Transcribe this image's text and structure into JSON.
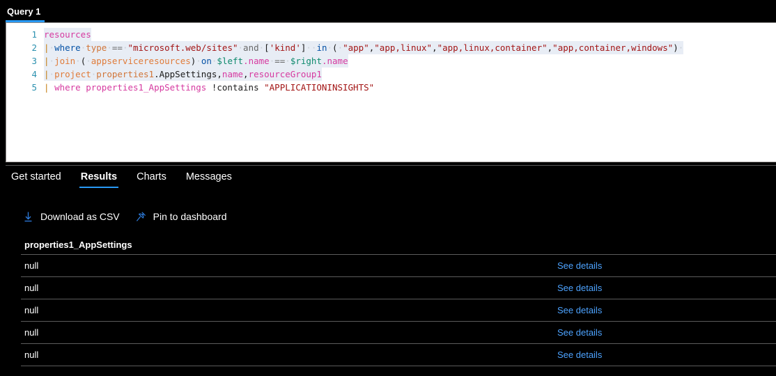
{
  "query_tab": {
    "label": "Query 1"
  },
  "editor": {
    "lines": [
      {
        "num": "1",
        "text": "resources"
      },
      {
        "num": "2",
        "text": "| where type == \"microsoft.web/sites\" and ['kind'] in ( \"app\",\"app,linux\",\"app,linux,container\",\"app,container,windows\")"
      },
      {
        "num": "3",
        "text": "| join ( appserviceresources) on $left.name == $right.name"
      },
      {
        "num": "4",
        "text": "| project properties1.AppSettings,name,resourceGroup1"
      },
      {
        "num": "5",
        "text": "| where properties1_AppSettings !contains \"APPLICATIONINSIGHTS\""
      }
    ],
    "tokens": {
      "l1": [
        {
          "t": "resources",
          "c": "t-res"
        }
      ],
      "l2": [
        {
          "t": "|",
          "c": "t-pipe"
        },
        {
          "t": "·",
          "c": "t-ws"
        },
        {
          "t": "where",
          "c": "t-kw"
        },
        {
          "t": "·",
          "c": "t-ws"
        },
        {
          "t": "type",
          "c": "t-col"
        },
        {
          "t": "·",
          "c": "t-ws"
        },
        {
          "t": "==",
          "c": "t-op"
        },
        {
          "t": "·",
          "c": "t-ws"
        },
        {
          "t": "\"microsoft.web/sites\"",
          "c": "t-str"
        },
        {
          "t": "·",
          "c": "t-ws"
        },
        {
          "t": "and",
          "c": "t-op"
        },
        {
          "t": "·",
          "c": "t-ws"
        },
        {
          "t": "[",
          "c": "t-plain"
        },
        {
          "t": "'kind'",
          "c": "t-str"
        },
        {
          "t": "]",
          "c": "t-plain"
        },
        {
          "t": "·",
          "c": "t-ws"
        },
        {
          "t": "·",
          "c": "t-ws"
        },
        {
          "t": "in",
          "c": "t-kw"
        },
        {
          "t": "·",
          "c": "t-ws"
        },
        {
          "t": "(",
          "c": "t-plain"
        },
        {
          "t": "·",
          "c": "t-ws"
        },
        {
          "t": "\"app\"",
          "c": "t-str"
        },
        {
          "t": ",",
          "c": "t-plain"
        },
        {
          "t": "\"app,linux\"",
          "c": "t-str"
        },
        {
          "t": ",",
          "c": "t-plain"
        },
        {
          "t": "\"app,linux,container\"",
          "c": "t-str"
        },
        {
          "t": ",",
          "c": "t-plain"
        },
        {
          "t": "\"app,container,windows\"",
          "c": "t-str"
        },
        {
          "t": ")",
          "c": "t-plain"
        },
        {
          "t": "·",
          "c": "t-ws"
        }
      ],
      "l3": [
        {
          "t": "|",
          "c": "t-pipe"
        },
        {
          "t": "·",
          "c": "t-ws"
        },
        {
          "t": "join",
          "c": "t-fn"
        },
        {
          "t": "·",
          "c": "t-ws"
        },
        {
          "t": "(",
          "c": "t-plain"
        },
        {
          "t": "·",
          "c": "t-ws"
        },
        {
          "t": "appserviceresources",
          "c": "t-fn"
        },
        {
          "t": ")",
          "c": "t-plain"
        },
        {
          "t": "·",
          "c": "t-ws"
        },
        {
          "t": "on",
          "c": "t-kw"
        },
        {
          "t": "·",
          "c": "t-ws"
        },
        {
          "t": "$left",
          "c": "t-var"
        },
        {
          "t": ".name",
          "c": "t-mem"
        },
        {
          "t": "·",
          "c": "t-ws"
        },
        {
          "t": "==",
          "c": "t-op"
        },
        {
          "t": "·",
          "c": "t-ws"
        },
        {
          "t": "$right",
          "c": "t-var"
        },
        {
          "t": ".name",
          "c": "t-mem"
        }
      ],
      "l4": [
        {
          "t": "|",
          "c": "t-pipe"
        },
        {
          "t": "·",
          "c": "t-ws"
        },
        {
          "t": "project",
          "c": "t-fn"
        },
        {
          "t": "·",
          "c": "t-ws"
        },
        {
          "t": "properties1",
          "c": "t-col"
        },
        {
          "t": ".AppSettings",
          "c": "t-plain"
        },
        {
          "t": ",",
          "c": "t-plain"
        },
        {
          "t": "name",
          "c": "t-mem"
        },
        {
          "t": ",",
          "c": "t-plain"
        },
        {
          "t": "resourceGroup1",
          "c": "t-mem"
        }
      ],
      "l5": [
        {
          "t": "|",
          "c": "t-pipe"
        },
        {
          "t": " ",
          "c": "t-plain"
        },
        {
          "t": "where",
          "c": "t-res"
        },
        {
          "t": " ",
          "c": "t-plain"
        },
        {
          "t": "properties1_AppSettings",
          "c": "t-mem"
        },
        {
          "t": " ",
          "c": "t-plain"
        },
        {
          "t": "!contains",
          "c": "t-plain"
        },
        {
          "t": " ",
          "c": "t-plain"
        },
        {
          "t": "\"APPLICATIONINSIGHTS\"",
          "c": "t-str"
        }
      ]
    }
  },
  "result_tabs": [
    {
      "label": "Get started",
      "active": false
    },
    {
      "label": "Results",
      "active": true
    },
    {
      "label": "Charts",
      "active": false
    },
    {
      "label": "Messages",
      "active": false
    }
  ],
  "commands": [
    {
      "label": "Download as CSV",
      "icon": "download-icon"
    },
    {
      "label": "Pin to dashboard",
      "icon": "pin-icon"
    }
  ],
  "grid": {
    "columns": [
      "properties1_AppSettings"
    ],
    "link_label": "See details",
    "rows": [
      {
        "value": "null"
      },
      {
        "value": "null"
      },
      {
        "value": "null"
      },
      {
        "value": "null"
      },
      {
        "value": "null"
      }
    ]
  },
  "colors": {
    "accent": "#2899f5",
    "link": "#4da3ff",
    "background": "#000000",
    "editor_background": "#ffffff",
    "selection": "#e8edf5"
  }
}
